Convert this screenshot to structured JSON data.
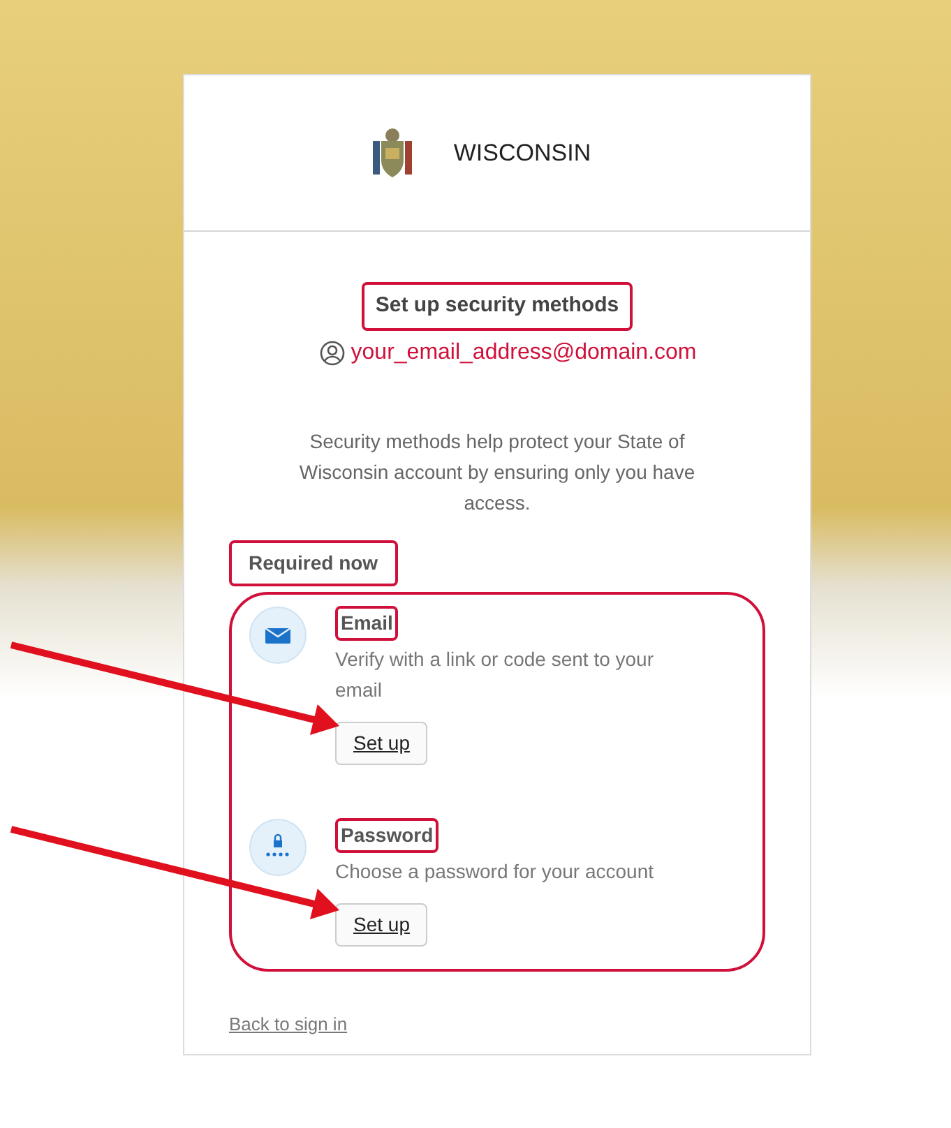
{
  "header": {
    "title": "WISCONSIN"
  },
  "heading": {
    "text": "Set up security methods",
    "highlighted": true
  },
  "account": {
    "email": "your_email_address@domain.com"
  },
  "description": "Security methods help protect your State of Wisconsin account by ensuring only you have access.",
  "required_section": {
    "label": "Required now",
    "label_highlighted": true,
    "group_highlighted": true,
    "methods": [
      {
        "kind": "email",
        "title": "Email",
        "highlighted": true,
        "description": "Verify with a link or code sent to your email",
        "button": "Set up",
        "arrow": true
      },
      {
        "kind": "password",
        "title": "Password",
        "highlighted": true,
        "description": "Choose a password for your account",
        "button": "Set up",
        "arrow": true
      }
    ]
  },
  "back_link": "Back to sign in"
}
